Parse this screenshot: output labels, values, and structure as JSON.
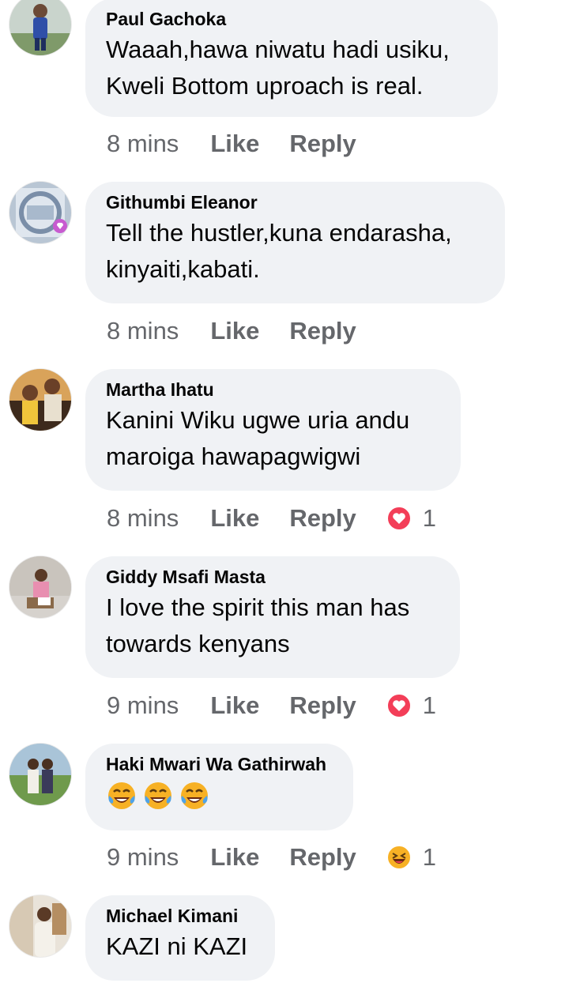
{
  "comments": [
    {
      "author": "Paul Gachoka",
      "text": "Waaah,hawa niwatu hadi usiku,\nKweli Bottom uproach is real.",
      "time": "8 mins",
      "like_label": "Like",
      "reply_label": "Reply",
      "reaction": null
    },
    {
      "author": "Githumbi Eleanor",
      "text": "Tell the hustler,kuna endarasha,\nkinyaiti,kabati.",
      "time": "8 mins",
      "like_label": "Like",
      "reply_label": "Reply",
      "reaction": null
    },
    {
      "author": "Martha Ihatu",
      "text": "Kanini Wiku ugwe uria andu\nmaroiga hawapagwigwi",
      "time": "8 mins",
      "like_label": "Like",
      "reply_label": "Reply",
      "reaction": {
        "icon": "love-reaction-icon",
        "count": "1"
      }
    },
    {
      "author": "Giddy Msafi Masta",
      "text": "I love the spirit this man has\ntowards kenyans",
      "time": "9 mins",
      "like_label": "Like",
      "reply_label": "Reply",
      "reaction": {
        "icon": "love-reaction-icon",
        "count": "1"
      }
    },
    {
      "author": "Haki Mwari Wa Gathirwah",
      "text": "",
      "emojis": [
        "tears-of-joy",
        "tears-of-joy",
        "tears-of-joy"
      ],
      "time": "9 mins",
      "like_label": "Like",
      "reply_label": "Reply",
      "reaction": {
        "icon": "haha-reaction-icon",
        "count": "1"
      }
    },
    {
      "author": "Michael Kimani",
      "text": "KAZI ni KAZI",
      "time": null,
      "like_label": null,
      "reply_label": null,
      "reaction": null
    }
  ],
  "colors": {
    "bubble": "#f0f2f5",
    "meta_text": "#65676b",
    "love_red": "#f33e58",
    "haha_yellow": "#f7b125"
  }
}
